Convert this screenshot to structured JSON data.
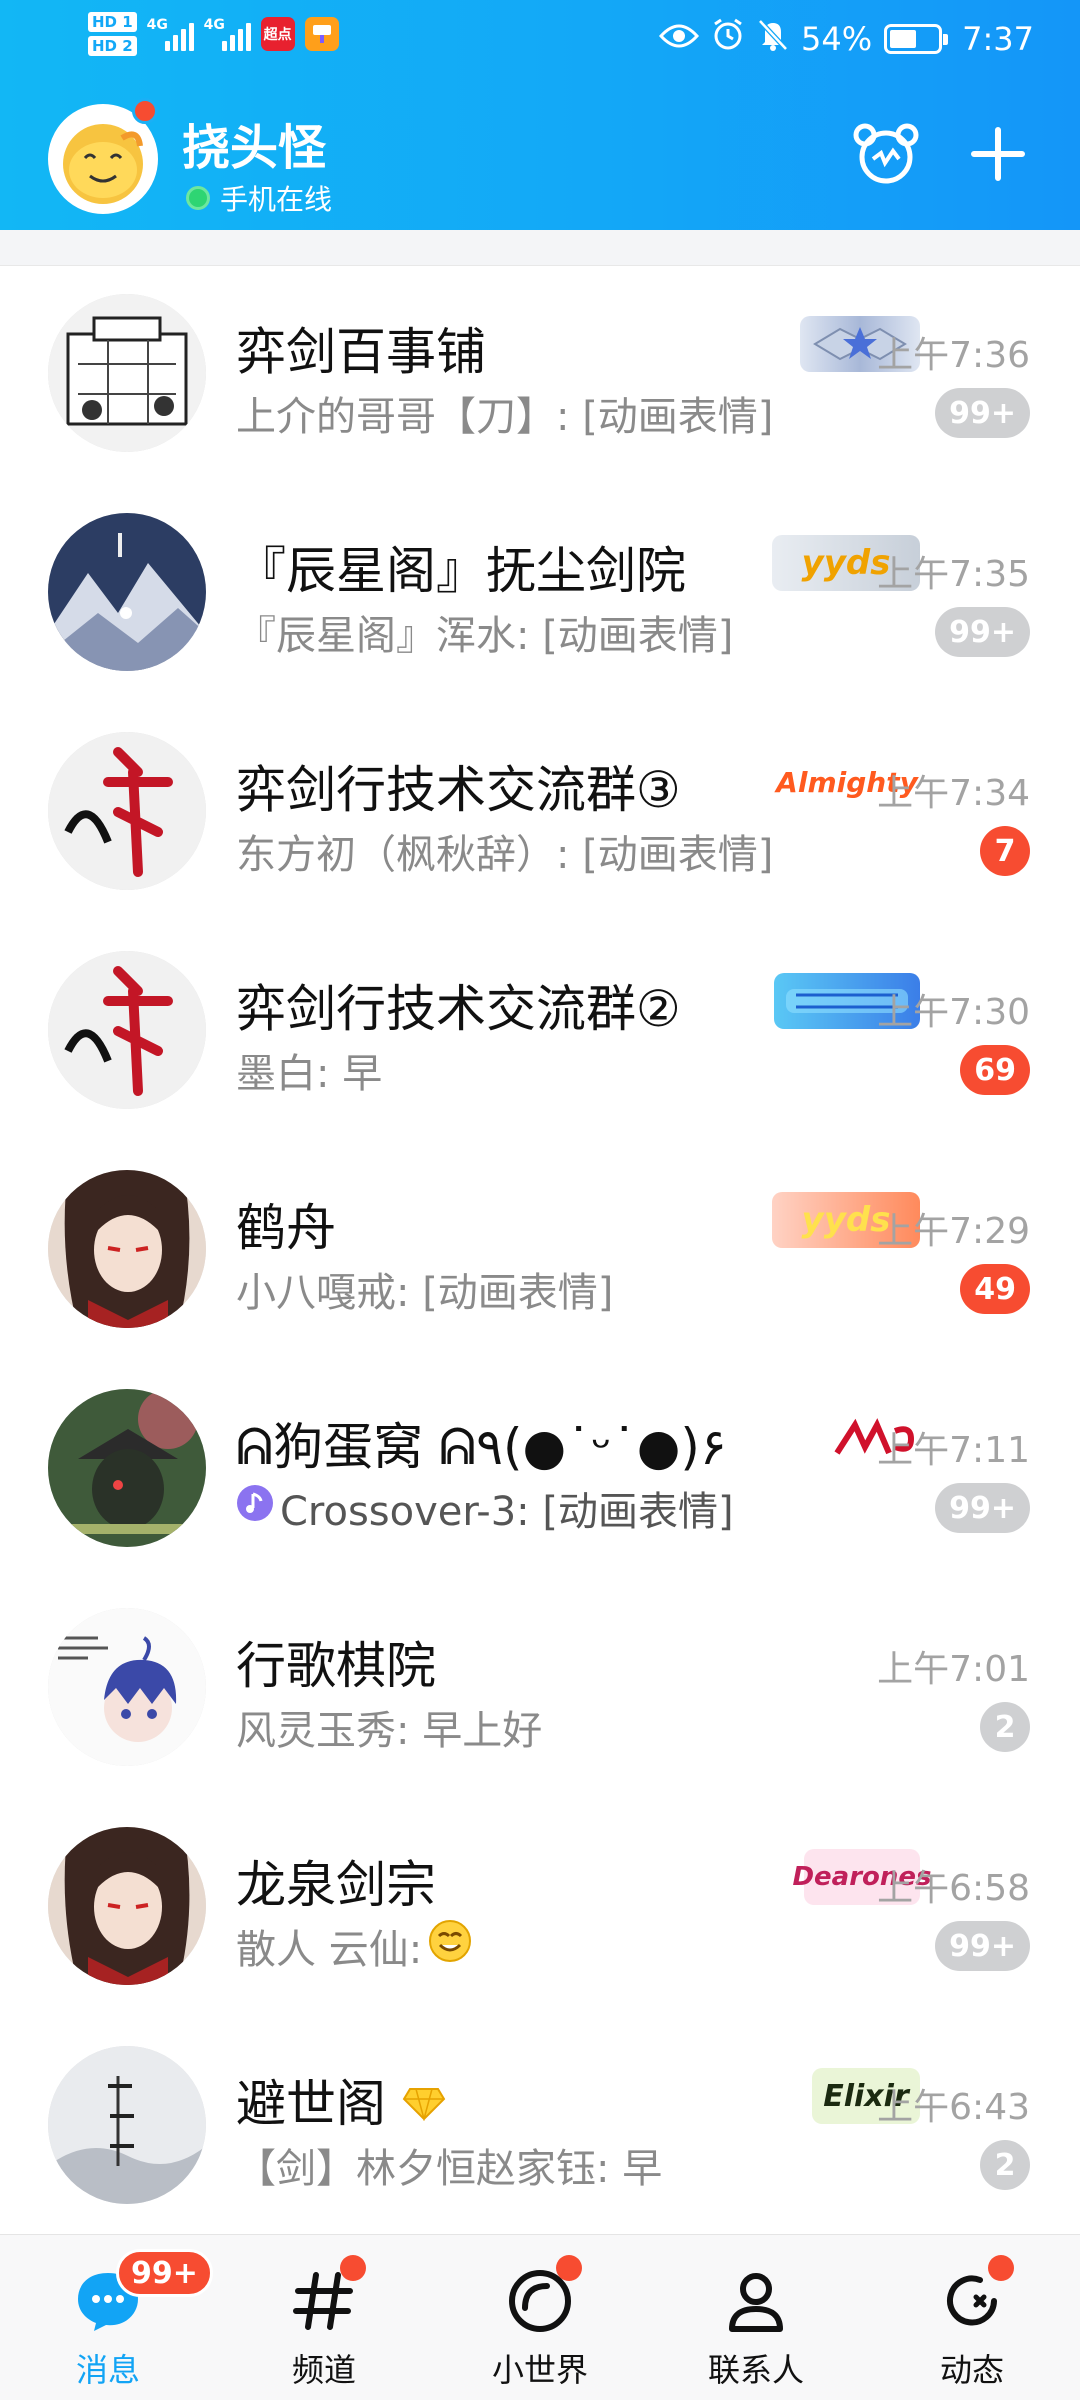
{
  "status": {
    "hd1": "HD 1",
    "hd2": "HD 2",
    "net1": "4G",
    "net2": "4G",
    "app1": "超点",
    "battery": "54%",
    "time": "7:37"
  },
  "profile": {
    "name": "挠头怪",
    "status_text": "手机在线"
  },
  "chats": [
    {
      "title": "弈剑百事铺",
      "preview": "上介的哥哥【刀】: [动画表情]",
      "time": "上午7:36",
      "badge": "",
      "count": "99+",
      "count_style": "gray"
    },
    {
      "title": "『辰星阁』抚尘剑院",
      "preview": "『辰星阁』浑水: [动画表情]",
      "time": "上午7:35",
      "badge": "yyds",
      "count": "99+",
      "count_style": "gray"
    },
    {
      "title": "弈剑行技术交流群③",
      "preview": "东方初（枫秋辞）: [动画表情]",
      "time": "上午7:34",
      "badge": "Almighty",
      "count": "7",
      "count_style": "red"
    },
    {
      "title": "弈剑行技术交流群②",
      "preview": "墨白: 早",
      "time": "上午7:30",
      "badge": "",
      "count": "69",
      "count_style": "red"
    },
    {
      "title": "鹤舟",
      "preview": "小八嘎戒: [动画表情]",
      "time": "上午7:29",
      "badge": "yyds",
      "count": "49",
      "count_style": "red"
    },
    {
      "title": "ᕱ狗蛋窝 ᕱ٩(●˙ᵕ˙●)۶",
      "preview": "Crossover-3: [动画表情]",
      "time": "上午7:11",
      "badge": "",
      "count": "99+",
      "count_style": "gray"
    },
    {
      "title": "行歌棋院",
      "preview": "风灵玉秀: 早上好",
      "time": "上午7:01",
      "badge": "",
      "count": "2",
      "count_style": "gray"
    },
    {
      "title": "龙泉剑宗",
      "preview": "散人 云仙:",
      "time": "上午6:58",
      "badge": "Dearones",
      "count": "99+",
      "count_style": "gray"
    },
    {
      "title": "避世阁",
      "preview": "【剑】林夕恒赵家钰: 早",
      "time": "上午6:43",
      "badge": "Elixir",
      "count": "2",
      "count_style": "gray"
    }
  ],
  "nav": {
    "messages": "消息",
    "messages_badge": "99+",
    "channels": "频道",
    "small_world": "小世界",
    "contacts": "联系人",
    "moments": "动态"
  },
  "colors": {
    "header": "#12b7f5",
    "accent": "#12a4f5",
    "unread_red": "#f74c31",
    "muted_badge": "#cfd0d2"
  }
}
